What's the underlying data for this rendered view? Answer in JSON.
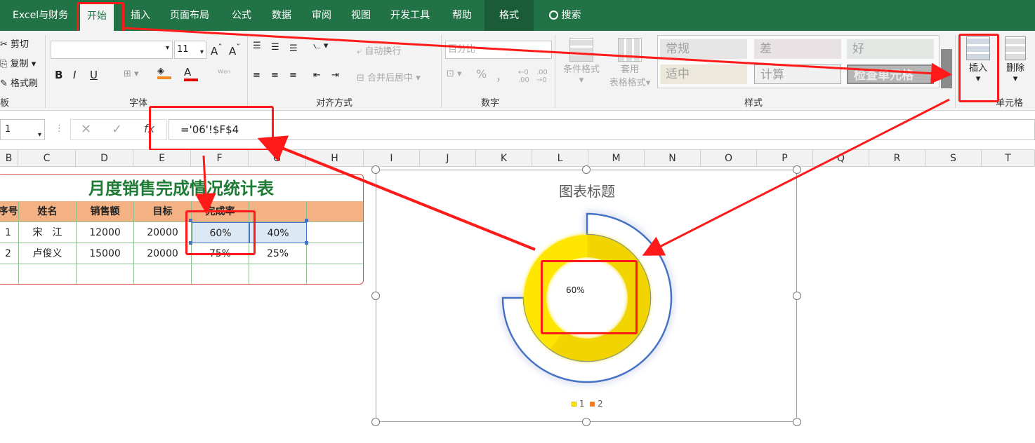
{
  "tabs": [
    {
      "label": "Excel与财务",
      "x": 0
    },
    {
      "label": "开始",
      "x": 0,
      "active": true
    },
    {
      "label": "插入"
    },
    {
      "label": "页面布局"
    },
    {
      "label": "公式"
    },
    {
      "label": "数据"
    },
    {
      "label": "审阅"
    },
    {
      "label": "视图"
    },
    {
      "label": "开发工具"
    },
    {
      "label": "帮助"
    },
    {
      "label": "格式"
    },
    {
      "label": "搜索"
    }
  ],
  "ribbon": {
    "clipboard": {
      "cut": "剪切",
      "copy": "复制",
      "format_painter": "格式刷",
      "group": "板"
    },
    "font": {
      "font_name": "",
      "font_size": "11",
      "group": "字体",
      "bold": "B",
      "italic": "I",
      "underline": "U"
    },
    "align": {
      "wrap": "自动换行",
      "merge": "合并后居中",
      "group": "对齐方式"
    },
    "number": {
      "format": "百分比",
      "group": "数字",
      "percent": "%",
      "comma": "，"
    },
    "styles": {
      "cond_format": "条件格式",
      "table_format_1": "套用",
      "table_format_2": "表格格式",
      "group": "样式",
      "cells": [
        "常规",
        "差",
        "好",
        "适中",
        "计算",
        "检查单元格"
      ]
    },
    "cells_grp": {
      "insert": "插入",
      "delete": "删除",
      "group": "单元格"
    }
  },
  "formula_bar": {
    "name_box": "1",
    "formula": "='06'!$F$4",
    "fx": "fx"
  },
  "columns": [
    "B",
    "C",
    "D",
    "E",
    "F",
    "G",
    "H",
    "I",
    "J",
    "K",
    "L",
    "M",
    "N",
    "O",
    "P",
    "Q",
    "R",
    "S",
    "T"
  ],
  "table": {
    "title": "月度销售完成情况统计表",
    "headers": [
      "序号",
      "姓名",
      "销售额",
      "目标",
      "完成率",
      ""
    ],
    "rows": [
      [
        "1",
        "宋　江",
        "12000",
        "20000",
        "60%",
        "40%"
      ],
      [
        "2",
        "卢俊义",
        "15000",
        "20000",
        "75%",
        "25%"
      ]
    ]
  },
  "chart_data": {
    "type": "pie",
    "title": "图表标题",
    "series": [
      {
        "name": "1",
        "values": [
          60,
          40
        ]
      },
      {
        "name": "2",
        "values": [
          75,
          25
        ]
      }
    ],
    "center_label": "60%",
    "legend": [
      "1",
      "2"
    ],
    "legend_position": "bottom",
    "colors": {
      "series1": "#FFE600",
      "series2": "#4472C4",
      "legend1": "#FFE600",
      "legend2": "#ED7D31"
    }
  }
}
